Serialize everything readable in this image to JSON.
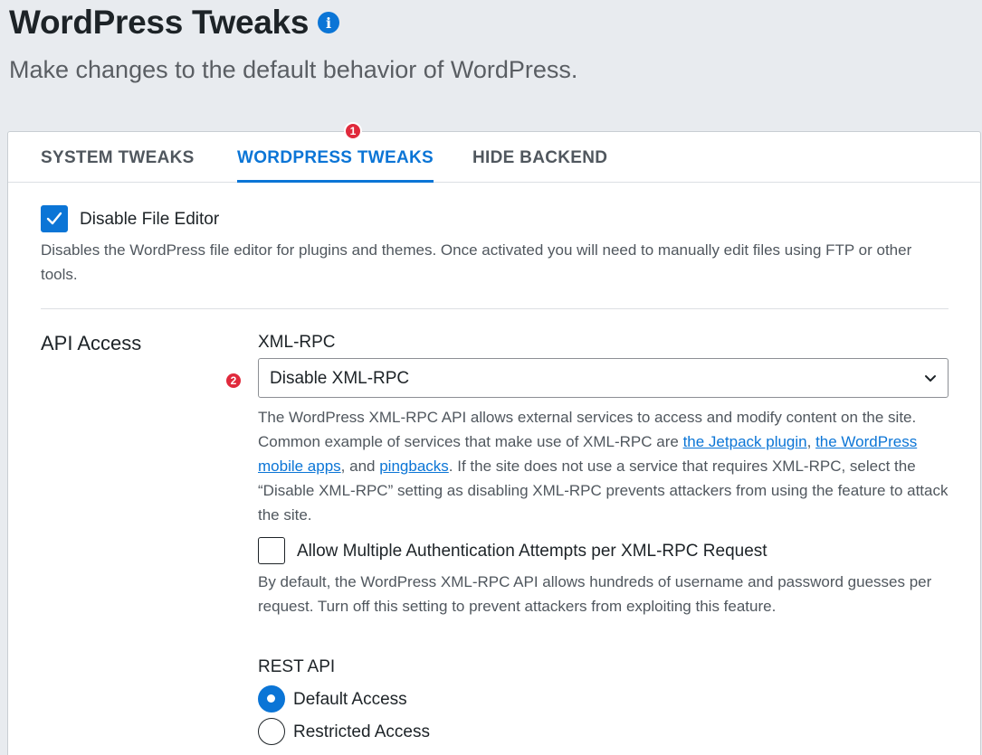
{
  "header": {
    "title": "WordPress Tweaks",
    "info_icon": "i",
    "subtitle": "Make changes to the default behavior of WordPress."
  },
  "tabs": [
    {
      "label": "SYSTEM TWEAKS",
      "active": false
    },
    {
      "label": "WORDPRESS TWEAKS",
      "active": true
    },
    {
      "label": "HIDE BACKEND",
      "active": false
    }
  ],
  "badges": [
    "1",
    "2"
  ],
  "file_editor": {
    "label": "Disable File Editor",
    "checked": true,
    "description": "Disables the WordPress file editor for plugins and themes. Once activated you will need to manually edit files using FTP or other tools."
  },
  "api_access": {
    "section_label": "API Access",
    "xmlrpc": {
      "label": "XML-RPC",
      "selected": "Disable XML-RPC",
      "desc_part1": "The WordPress XML-RPC API allows external services to access and modify content on the site. Common example of services that make use of XML-RPC are ",
      "link_jetpack": "the Jetpack plugin",
      "desc_part2": ", ",
      "link_mobile": "the WordPress mobile apps",
      "desc_part3": ", and ",
      "link_pingbacks": "pingbacks",
      "desc_part4": ". If the site does not use a service that requires XML-RPC, select the “Disable XML-RPC” setting as disabling XML-RPC prevents attackers from using the feature to attack the site."
    },
    "multi_auth": {
      "label": "Allow Multiple Authentication Attempts per XML-RPC Request",
      "checked": false,
      "description": "By default, the WordPress XML-RPC API allows hundreds of username and password guesses per request. Turn off this setting to prevent attackers from exploiting this feature."
    },
    "rest_api": {
      "label": "REST API",
      "options": [
        {
          "label": "Default Access",
          "checked": true
        },
        {
          "label": "Restricted Access",
          "checked": false
        }
      ]
    }
  },
  "colors": {
    "accent": "#0b75d6",
    "badge": "#e02a3c",
    "background": "#e8ebef"
  }
}
